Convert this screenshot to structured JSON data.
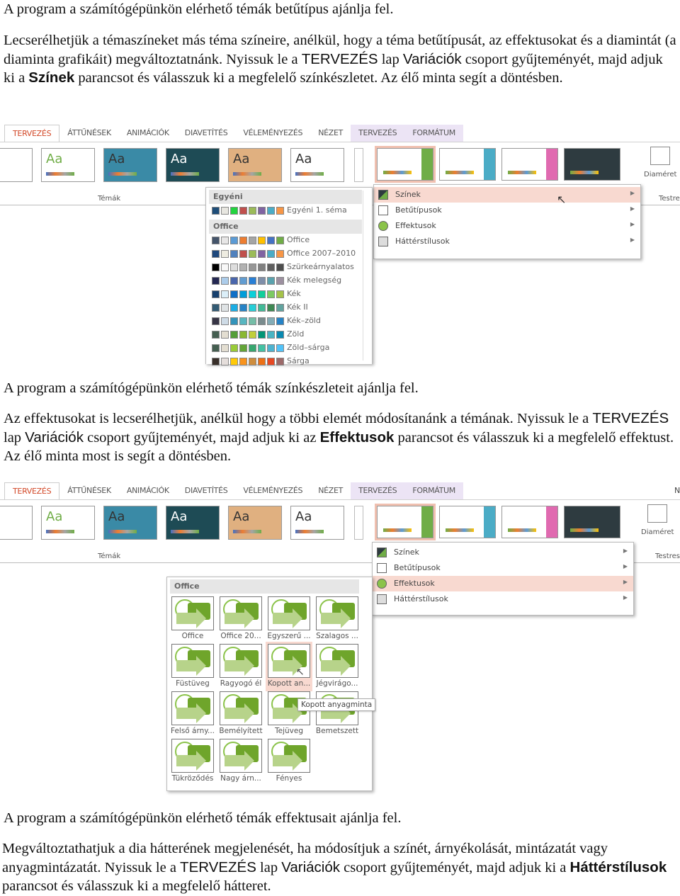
{
  "p1": "A program a számítógépünkön elérhető témák betűtípus ajánlja fel.",
  "p2": {
    "t1": "Lecserélhetjük a témaszíneket más téma színeire, anélkül, hogy a téma betűtípusát, az effektusokat és a diamintát (a diaminta grafikáit) megváltoztatnánk. Nyissuk le a ",
    "k1": "TERVEZÉS",
    "t2": " lap ",
    "k2": "Variációk",
    "t3": " csoport gyűjteményét, majd adjuk ki a ",
    "k3": "Színek",
    "t4": " parancsot és válasszuk ki a megfelelő színkészletet. Az élő minta segít a döntésben."
  },
  "ribbon": {
    "tabs": [
      "TERVEZÉS",
      "ÁTTŰNÉSEK",
      "ANIMÁCIÓK",
      "DIAVETÍTÉS",
      "VÉLEMÉNYEZÉS",
      "NÉZET"
    ],
    "ctx_tabs": [
      "TERVEZÉS",
      "FORMÁTUM"
    ],
    "themes_label": "Témák",
    "theme_thumb_text": "Aa",
    "slide_size": "Diaméret",
    "customize": "Testre",
    "ctx_tab2_extra": "N",
    "customize2": "Testres"
  },
  "variations_menu": {
    "items": [
      "Színek",
      "Betűtípusok",
      "Effektusok",
      "Háttérstílusok"
    ]
  },
  "colors_menu": {
    "custom_header": "Egyéni",
    "custom": [
      {
        "label": "Egyéni 1. séma",
        "colors": [
          "#1f4e79",
          "#e7e6e0",
          "#22d33f",
          "#c0504d",
          "#9bbb59",
          "#8064a2",
          "#4bacc6",
          "#f79646"
        ]
      }
    ],
    "office_header": "Office",
    "schemes": [
      {
        "label": "Office",
        "colors": [
          "#44546a",
          "#e7e6e6",
          "#5b9bd5",
          "#ed7d31",
          "#a5a5a5",
          "#ffc000",
          "#4472c4",
          "#70ad47"
        ]
      },
      {
        "label": "Office 2007–2010",
        "colors": [
          "#1f497d",
          "#eeece1",
          "#4f81bd",
          "#c0504d",
          "#9bbb59",
          "#8064a2",
          "#4bacc6",
          "#f79646"
        ]
      },
      {
        "label": "Szürkeárnyalatos",
        "colors": [
          "#000000",
          "#f8f8f8",
          "#dddddd",
          "#b2b2b2",
          "#969696",
          "#808080",
          "#5f5f5f",
          "#4d4d4d"
        ]
      },
      {
        "label": "Kék melegség",
        "colors": [
          "#242852",
          "#acccea",
          "#4a66ac",
          "#629dd1",
          "#297fd5",
          "#7f8fa9",
          "#5aa2ae",
          "#9d90a0"
        ]
      },
      {
        "label": "Kék",
        "colors": [
          "#17406d",
          "#dbeff9",
          "#0f6fc6",
          "#009dd9",
          "#0bd0d9",
          "#10cf9b",
          "#7cca62",
          "#a5c249"
        ]
      },
      {
        "label": "Kék II",
        "colors": [
          "#335b74",
          "#dfe3e5",
          "#1cade4",
          "#2683c6",
          "#27ced7",
          "#42ba97",
          "#3e8853",
          "#62a39f"
        ]
      },
      {
        "label": "Kék–zöld",
        "colors": [
          "#373545",
          "#cedbe6",
          "#3494ba",
          "#58b6c0",
          "#75bda7",
          "#7a8c8e",
          "#84acb6",
          "#2683c6"
        ]
      },
      {
        "label": "Zöld",
        "colors": [
          "#455f51",
          "#e3ded1",
          "#549e39",
          "#8ab833",
          "#c0cf3a",
          "#029676",
          "#4ab5c4",
          "#0989b1"
        ]
      },
      {
        "label": "Zöld–sárga",
        "colors": [
          "#455f51",
          "#e3ded1",
          "#99cb38",
          "#63a537",
          "#37a76f",
          "#44c1a3",
          "#4eb3cf",
          "#51c3f9"
        ]
      },
      {
        "label": "Sárga",
        "colors": [
          "#39302a",
          "#e5dedb",
          "#ffca08",
          "#f8931d",
          "#ce8d3e",
          "#ec7016",
          "#e64823",
          "#9c6a6a"
        ]
      }
    ]
  },
  "caption1": "A program a számítógépünkön elérhető témák színkészleteit ajánlja fel.",
  "p3": {
    "t1": "Az effektusokat is lecserélhetjük, anélkül hogy a többi elemét módosítanánk a témának. Nyissuk le a ",
    "k1": "TERVEZÉS",
    "t2": " lap ",
    "k2": "Variációk",
    "t3": " csoport gyűjteményét, majd adjuk ki az ",
    "k3": "Effektusok",
    "t4": " parancsot és válasszuk ki a megfelelő effektust. Az élő minta most is segít a döntésben."
  },
  "effects_menu": {
    "header": "Office",
    "items": [
      "Office",
      "Office 20...",
      "Egyszerű ...",
      "Szalagos ...",
      "Füstüveg",
      "Ragyogó él",
      "Kopott an...",
      "Jégvirágo...",
      "Felső árny...",
      "Bemélyített",
      "Tejüveg",
      "Bemetszett",
      "Tükröződés",
      "Nagy árn...",
      "Fényes"
    ],
    "selected": "Kopott an...",
    "tooltip": "Kopott anyagminta"
  },
  "caption2": "A program a számítógépünkön elérhető témák effektusait ajánlja fel.",
  "p4": {
    "t1": "Megváltoztathatjuk a dia hátterének megjelenését, ha módosítjuk a színét, árnyékolását, mintázatát vagy anyagmintázatát. Nyissuk le a ",
    "k1": "TERVEZÉS",
    "t2": " lap ",
    "k2": "Variációk",
    "t3": " csoport gyűjteményét, majd adjuk ki a ",
    "k3": "Háttérstílusok",
    "t4": " parancsot és válasszuk ki a megfelelő hátteret."
  },
  "colors": {
    "accent": "#d24726",
    "highlight": "#f8d9d0",
    "context_tab": "#ece4f5",
    "effect_green": "#6fa52b"
  }
}
